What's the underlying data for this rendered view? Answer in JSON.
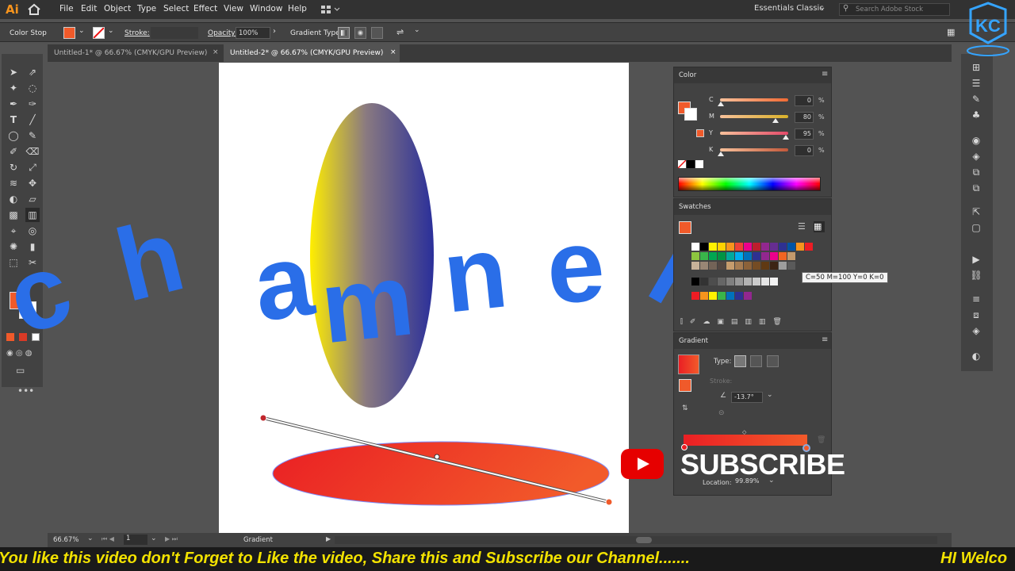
{
  "app": {
    "logo": "Ai"
  },
  "menu": [
    "File",
    "Edit",
    "Object",
    "Type",
    "Select",
    "Effect",
    "View",
    "Window",
    "Help"
  ],
  "workspace": "Essentials Classic",
  "search_placeholder": "Search Adobe Stock",
  "control_bar": {
    "mode_label": "Color Stop",
    "stroke_label": "Stroke:",
    "opacity_label": "Opacity:",
    "opacity_value": "100%",
    "gradient_type_label": "Gradient Type:"
  },
  "tabs": [
    {
      "label": "Untitled-1* @ 66.67% (CMYK/GPU Preview)",
      "active": false
    },
    {
      "label": "Untitled-2* @ 66.67% (CMYK/GPU Preview)",
      "active": true
    }
  ],
  "color_panel": {
    "title": "Color",
    "channels": [
      {
        "name": "C",
        "value": "0",
        "pct": 0.0,
        "track": "#f06a34"
      },
      {
        "name": "M",
        "value": "80",
        "pct": 0.8,
        "track": "#d9b22a"
      },
      {
        "name": "Y",
        "value": "95",
        "pct": 0.95,
        "track": "#e34a6a"
      },
      {
        "name": "K",
        "value": "0",
        "pct": 0.0,
        "track": "#c2583a"
      }
    ],
    "unit": "%",
    "fill_color": "#f05a2a"
  },
  "swatches_panel": {
    "title": "Swatches",
    "tooltip": "C=50 M=100 Y=0 K=0"
  },
  "gradient_panel": {
    "title": "Gradient",
    "type_label": "Type:",
    "stroke_label": "Stroke:",
    "angle": "-13.7°",
    "location_label": "Location:",
    "location_value": "99.89%"
  },
  "status": {
    "zoom": "66.67%",
    "artboard": "1",
    "tool_name": "Gradient"
  },
  "canvas": {
    "watermark_text": "channel",
    "letters": [
      "c",
      "h",
      "a",
      "m",
      "n",
      "e",
      "l"
    ]
  },
  "overlay": {
    "subscribe": "SUBSCRIBE"
  },
  "ticker": {
    "line1": "You like this video don't Forget to Like the video, Share this and Subscribe our Channel.......",
    "line2": "HI Welco"
  },
  "colors": {
    "accent_blue": "#2a6ee8",
    "gradient_red": "#ee2a24",
    "gradient_orange": "#f0622a"
  }
}
